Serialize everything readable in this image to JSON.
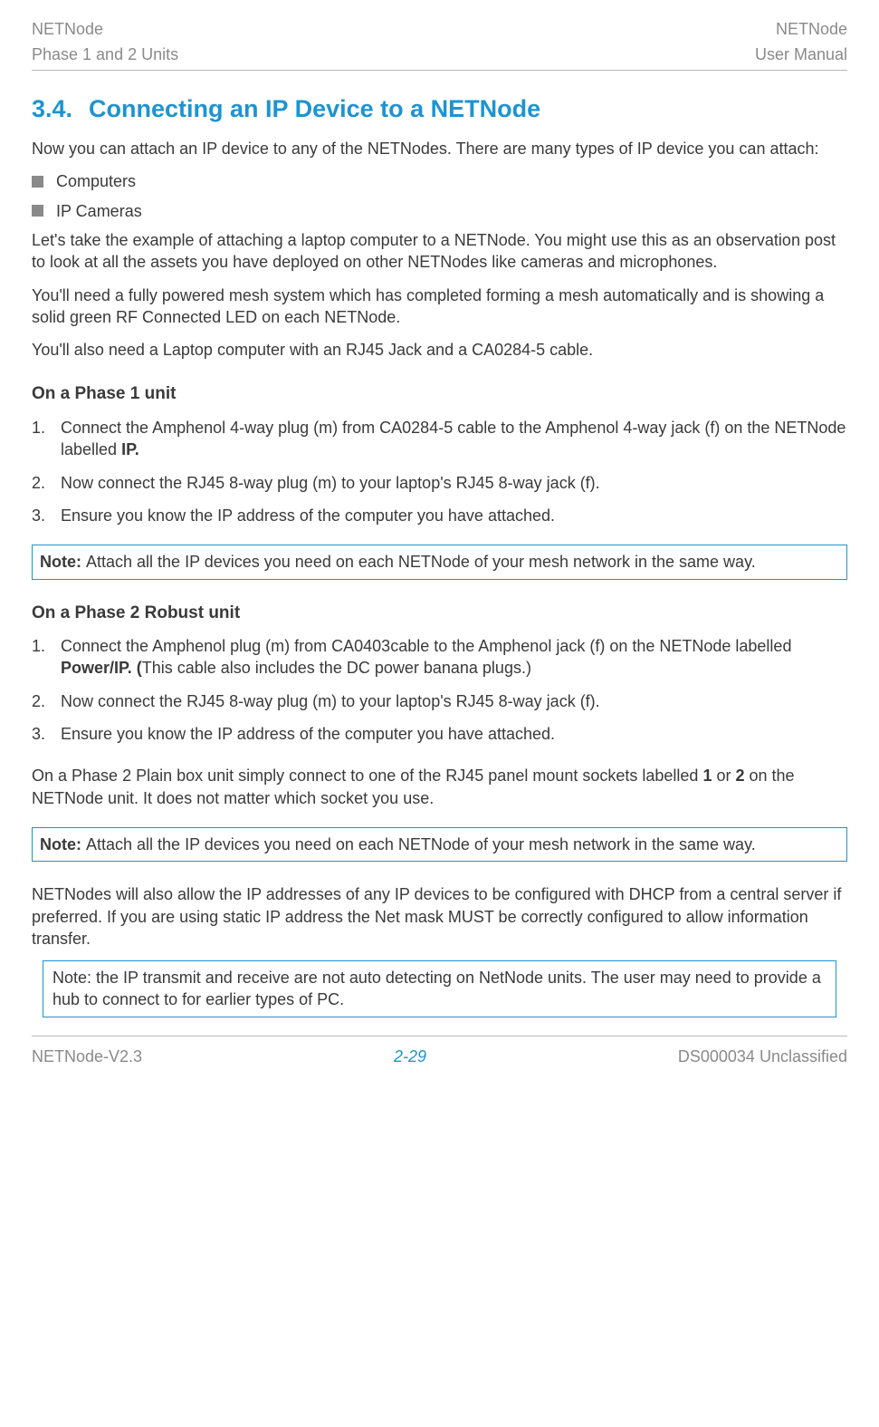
{
  "header": {
    "left_top": "NETNode",
    "left_bottom": "Phase 1 and 2 Units",
    "right_top": "NETNode",
    "right_bottom": "User Manual"
  },
  "section": {
    "number": "3.4.",
    "title": "Connecting an IP Device to a NETNode"
  },
  "p1": "Now you can attach an IP device to any of the NETNodes. There are many types of IP device you can attach:",
  "bullets": {
    "b1": "Computers",
    "b2": "IP Cameras"
  },
  "p2": "Let's take the example of attaching a laptop computer to a NETNode. You might use this as an observation post to look at all the assets you have deployed on other NETNodes like cameras and microphones.",
  "p3": "You'll need a fully powered mesh system which has completed forming a mesh automatically and is showing a solid green RF Connected LED on each NETNode.",
  "p4": "You'll also need a Laptop computer with an RJ45 Jack and a CA0284-5 cable.",
  "phase1": {
    "heading": "On a Phase 1 unit",
    "step1_a": "Connect the Amphenol 4-way plug (m) from CA0284-5 cable to the Amphenol 4-way jack (f) on the NETNode labelled ",
    "step1_bold": "IP.",
    "step2": "Now connect the RJ45 8-way plug (m) to your laptop's RJ45 8-way jack (f).",
    "step3": "Ensure you know the IP address of the computer you have attached."
  },
  "note1": {
    "bold": "Note: ",
    "text": "Attach all the IP devices you need on each NETNode of your mesh network in the same way."
  },
  "phase2": {
    "heading": "On a Phase 2 Robust unit",
    "step1_a": "Connect the Amphenol plug (m) from CA0403cable to the Amphenol jack (f) on the NETNode labelled ",
    "step1_bold": "Power/IP. (",
    "step1_b": "This cable also includes the DC power banana plugs.)",
    "step2": "Now connect the RJ45 8-way plug (m) to your laptop's RJ45 8-way jack (f).",
    "step3": "Ensure you know the IP address of the computer you have attached."
  },
  "p5_a": "On a Phase 2 Plain box unit simply connect to one of the RJ45 panel mount sockets labelled ",
  "p5_bold1": "1",
  "p5_b": " or ",
  "p5_bold2": "2",
  "p5_c": " on the NETNode unit. It does not matter which socket you use.",
  "note2": {
    "bold": "Note: ",
    "text": "Attach all the IP devices you need on each NETNode of your mesh network in the same way."
  },
  "p6": "NETNodes will also allow the IP addresses of any IP devices to be configured with DHCP from a central server if preferred. If you are using static IP address the Net mask MUST be correctly configured to allow information transfer.",
  "note3": "Note: the IP transmit and receive are not auto detecting on NetNode units. The user may need to provide a hub to connect to for earlier types of PC.",
  "footer": {
    "left": "NETNode-V2.3",
    "center": "2-29",
    "right": "DS000034 Unclassified"
  }
}
